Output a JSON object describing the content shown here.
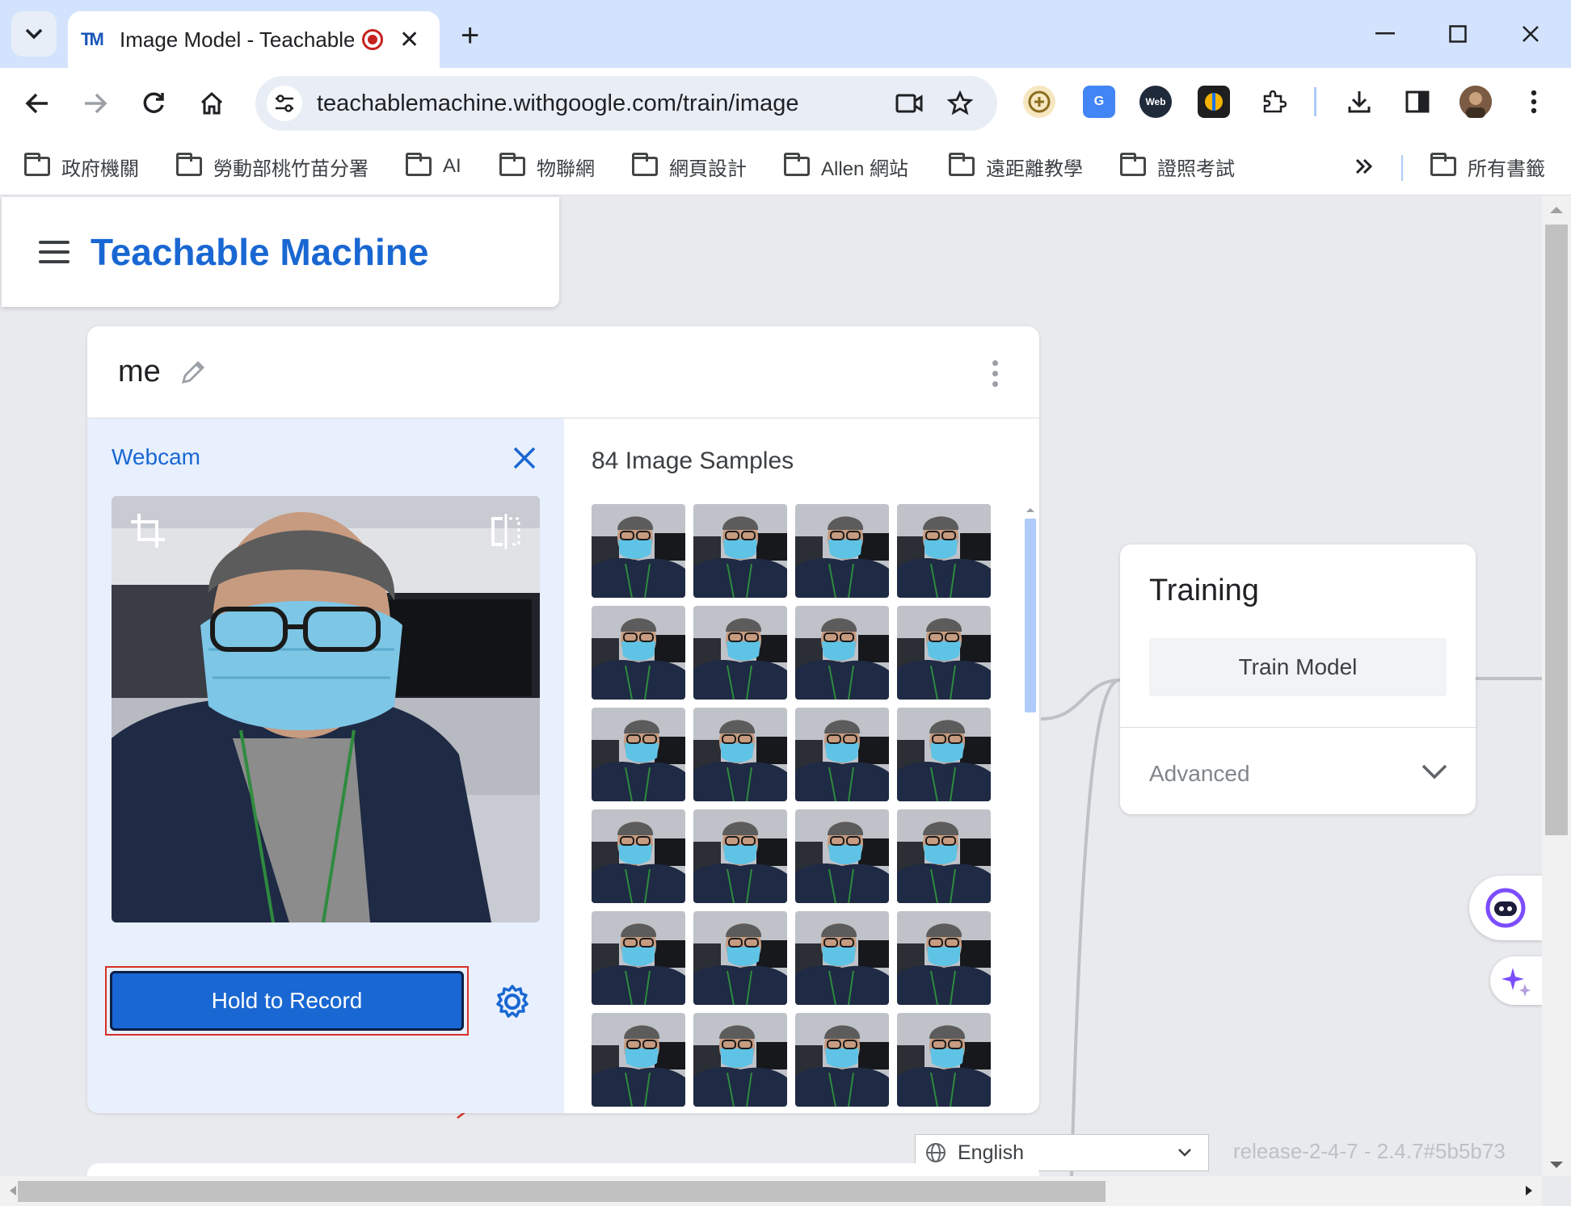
{
  "browser": {
    "tab_title": "Image Model - Teachable Machine",
    "url": "teachablemachine.withgoogle.com/train/image",
    "favicon_text": "TM",
    "bookmarks": [
      "政府機關",
      "勞動部桃竹苗分署",
      "AI",
      "物聯網",
      "網頁設計",
      "Allen 網站",
      "遠距離教學",
      "證照考試"
    ],
    "all_bookmarks": "所有書籤",
    "ext_web_label": "Web"
  },
  "app": {
    "brand": "Teachable Machine"
  },
  "class_card": {
    "name": "me",
    "webcam_label": "Webcam",
    "record_button": "Hold to Record",
    "samples_title": "84 Image Samples"
  },
  "training": {
    "title": "Training",
    "train_button": "Train Model",
    "advanced_label": "Advanced"
  },
  "footer": {
    "language": "English",
    "release": "release-2-4-7 - 2.4.7#5b5b73"
  },
  "colors": {
    "brand_blue": "#1967d2",
    "record_outline": "#d93025",
    "webcam_panel_bg": "#e8f0fe"
  }
}
